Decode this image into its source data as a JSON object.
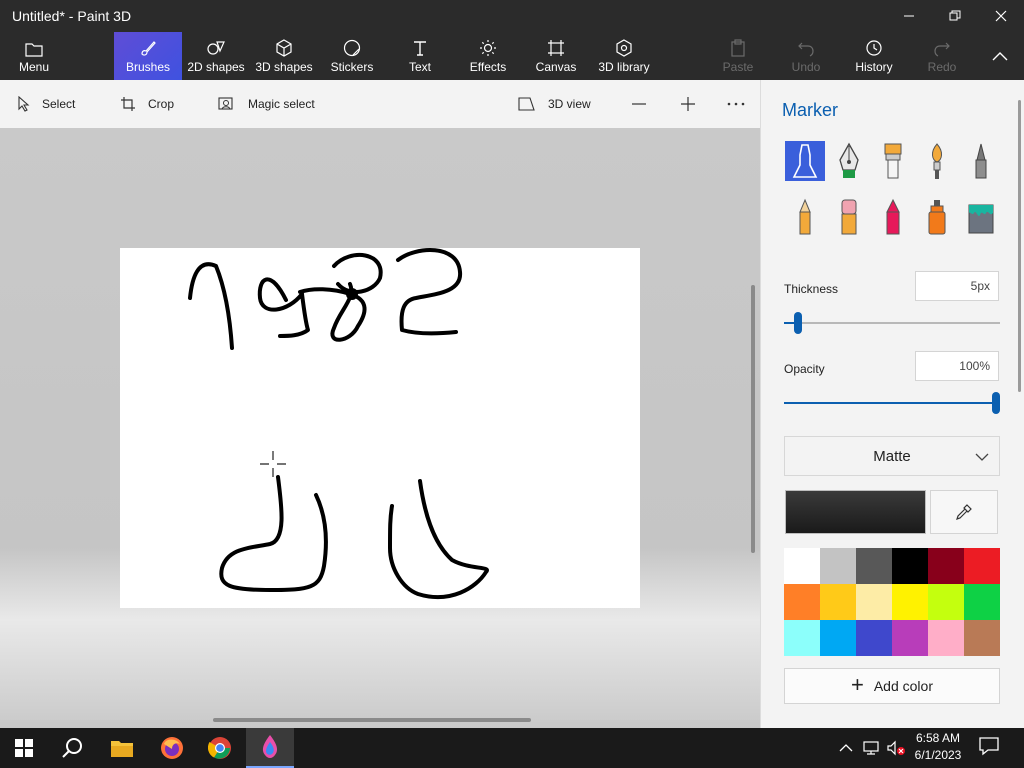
{
  "window": {
    "title": "Untitled* - Paint 3D",
    "minimize_icon": "minimize-icon",
    "maximize_icon": "restore-icon",
    "close_icon": "close-icon"
  },
  "ribbon": {
    "menu": "Menu",
    "brushes": "Brushes",
    "shapes2d": "2D shapes",
    "shapes3d": "3D shapes",
    "stickers": "Stickers",
    "text": "Text",
    "effects": "Effects",
    "canvas": "Canvas",
    "library": "3D library",
    "paste": "Paste",
    "undo": "Undo",
    "history": "History",
    "redo": "Redo",
    "active_color": "#4a50dc"
  },
  "toolbar": {
    "select": "Select",
    "crop": "Crop",
    "magic_select": "Magic select",
    "view3d": "3D view"
  },
  "panel": {
    "title": "Marker",
    "thickness_label": "Thickness",
    "thickness_value": "5px",
    "opacity_label": "Opacity",
    "opacity_value": "100%",
    "finish": "Matte",
    "add_color": "Add color",
    "thickness_level": 0.05,
    "opacity_level": 1.0,
    "palette": [
      "#ffffff",
      "#c3c3c3",
      "#585858",
      "#000000",
      "#88001b",
      "#ec1c24",
      "#ff7f27",
      "#ffca18",
      "#fdeca6",
      "#fff200",
      "#c4ff0e",
      "#0ed145",
      "#8cfffb",
      "#00a8f3",
      "#3f48cc",
      "#b83dba",
      "#ffaec8",
      "#b97a56"
    ]
  },
  "taskbar": {
    "time": "6:58 AM",
    "date": "6/1/2023"
  }
}
